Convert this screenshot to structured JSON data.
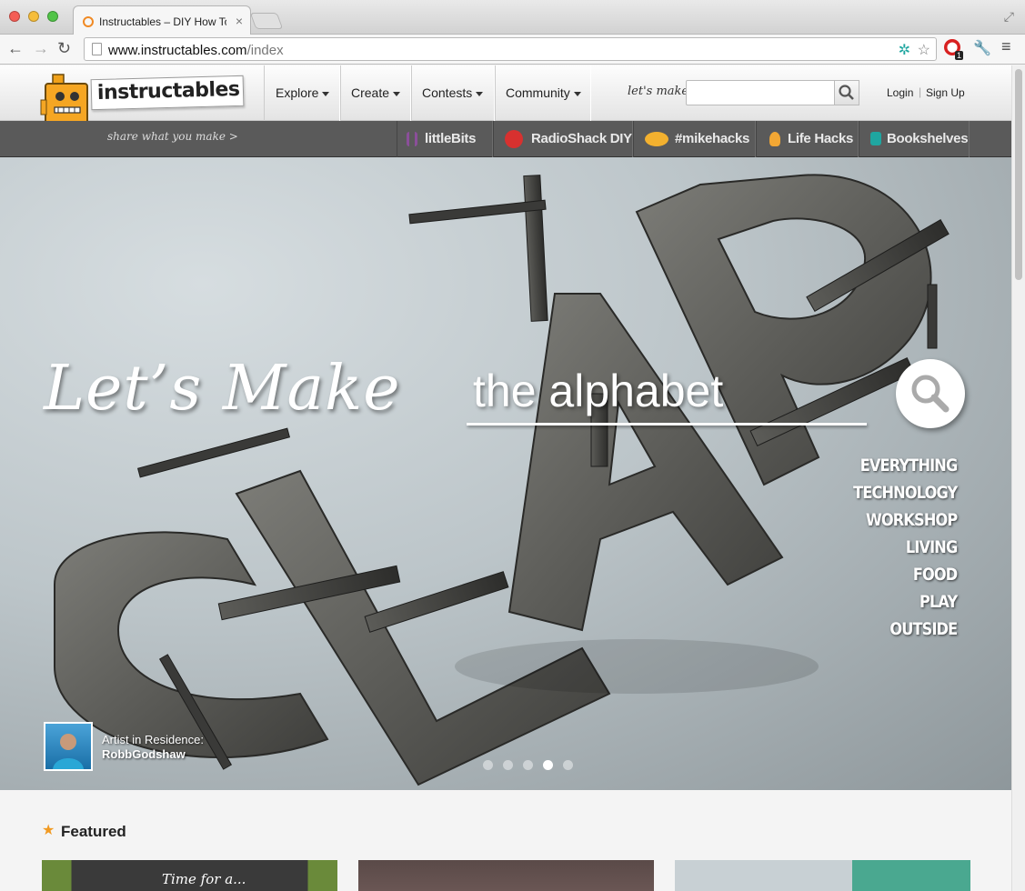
{
  "browser": {
    "tab_title": "Instructables – DIY How To Make Instructions",
    "url_host": "www.instructables.com",
    "url_path": "/index",
    "extension_badge": "1"
  },
  "site": {
    "logo_text": "instructables",
    "tagline": "share what you make >",
    "menu": [
      {
        "label": "Explore"
      },
      {
        "label": "Create"
      },
      {
        "label": "Contests"
      },
      {
        "label": "Community"
      }
    ],
    "search_label": "let's make",
    "search_placeholder": "",
    "login": "Login",
    "separator": "|",
    "signup": "Sign Up",
    "channels": [
      {
        "label": "littleBits",
        "icon": "littlebits-icon",
        "color": "#8b4f9a"
      },
      {
        "label": "RadioShack DIY",
        "icon": "radioshack-icon",
        "color": "#d8312f"
      },
      {
        "label": "#mikehacks",
        "icon": "mikehacks-icon",
        "color": "#f3b12f"
      },
      {
        "label": "Life Hacks",
        "icon": "lightbulb-icon",
        "color": "#f2a734"
      },
      {
        "label": "Bookshelves",
        "icon": "book-icon",
        "color": "#1fa6a0"
      }
    ]
  },
  "hero": {
    "heading": "Let’s Make",
    "query": "the alphabet",
    "categories": [
      "EVERYTHING",
      "TECHNOLOGY",
      "WORKSHOP",
      "LIVING",
      "FOOD",
      "PLAY",
      "OUTSIDE"
    ],
    "artist_label": "Artist in Residence:",
    "artist_name": "RobbGodshaw",
    "slides": {
      "count": 5,
      "active": 4
    }
  },
  "featured": {
    "title": "Featured",
    "card_text": "Time for a..."
  },
  "colors": {
    "accent_orange": "#f19a22",
    "header_bar": "#5a5a5a"
  }
}
